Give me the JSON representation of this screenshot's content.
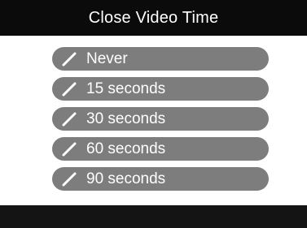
{
  "header": {
    "title": "Close Video Time"
  },
  "menu": {
    "items": [
      {
        "label": "Never",
        "icon": "checkmark-icon"
      },
      {
        "label": "15 seconds",
        "icon": "checkmark-icon"
      },
      {
        "label": "30 seconds",
        "icon": "checkmark-icon"
      },
      {
        "label": "60 seconds",
        "icon": "checkmark-icon"
      },
      {
        "label": "90 seconds",
        "icon": "checkmark-icon"
      }
    ]
  },
  "colors": {
    "titlebar_bg": "#0b0b0b",
    "item_bg": "#7d7d7d",
    "text": "#ffffff",
    "background": "#ffffff",
    "bottombar_bg": "#141414"
  }
}
